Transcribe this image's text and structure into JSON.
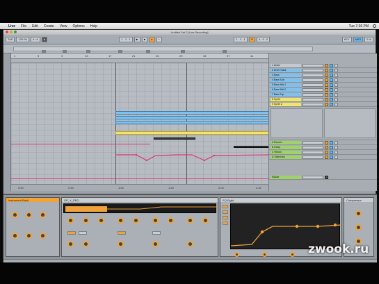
{
  "menubar": {
    "apple_glyph": "",
    "app_name": "Live",
    "items": [
      "File",
      "Edit",
      "Create",
      "View",
      "Options",
      "Help"
    ],
    "clock": "Tue 7:36 PM"
  },
  "window": {
    "title": "Untitled Set 3  [Live Recording]"
  },
  "control_bar": {
    "tempo": "120.00",
    "signature": "4 / 4",
    "position": "1 . 1 . 1",
    "loop_start": "1 . 1 . 1",
    "loop_length": "4 . 0 . 0",
    "key": "KEY",
    "midi": "MIDI",
    "cpu": "0 %"
  },
  "ruler": {
    "bars": [
      "1",
      "5",
      "9",
      "13",
      "17",
      "21",
      "25",
      "29",
      "33",
      "37",
      "41"
    ],
    "time": [
      "0:00",
      "0:30",
      "1:00",
      "1:30",
      "2:00",
      "2:30"
    ]
  },
  "tracks": [
    {
      "name": "1 Audio",
      "color": "grey"
    },
    {
      "name": "2 Drum Rack",
      "color": "blue"
    },
    {
      "name": "3 Bass",
      "color": "blue"
    },
    {
      "name": "4 Bass Sub",
      "color": "blue"
    },
    {
      "name": "5 Bass Mid 1",
      "color": "blue"
    },
    {
      "name": "6 Bass Mid 2",
      "color": "blue"
    },
    {
      "name": "7 Bass Top",
      "color": "blue"
    },
    {
      "name": "8 Synth",
      "color": "yellow"
    },
    {
      "name": "9 Synth 2",
      "color": "yellow"
    },
    {
      "name": "A Reverb",
      "color": "green"
    },
    {
      "name": "B Delay",
      "color": "green"
    },
    {
      "name": "C Return",
      "color": "green"
    },
    {
      "name": "D Sidechain",
      "color": "green"
    },
    {
      "name": "Master",
      "color": "green"
    }
  ],
  "devices": {
    "instrument_rack": "Instrument Rack",
    "synth": "OP_X_PRO",
    "eq": "EQ Eight",
    "compressor": "Compressor"
  },
  "watermark": "zwook.ru",
  "colors": {
    "accent_orange": "#f0a33a",
    "clip_blue": "#7fc1ee",
    "clip_yellow": "#f4e26a",
    "automation_pink": "#e0357a"
  }
}
